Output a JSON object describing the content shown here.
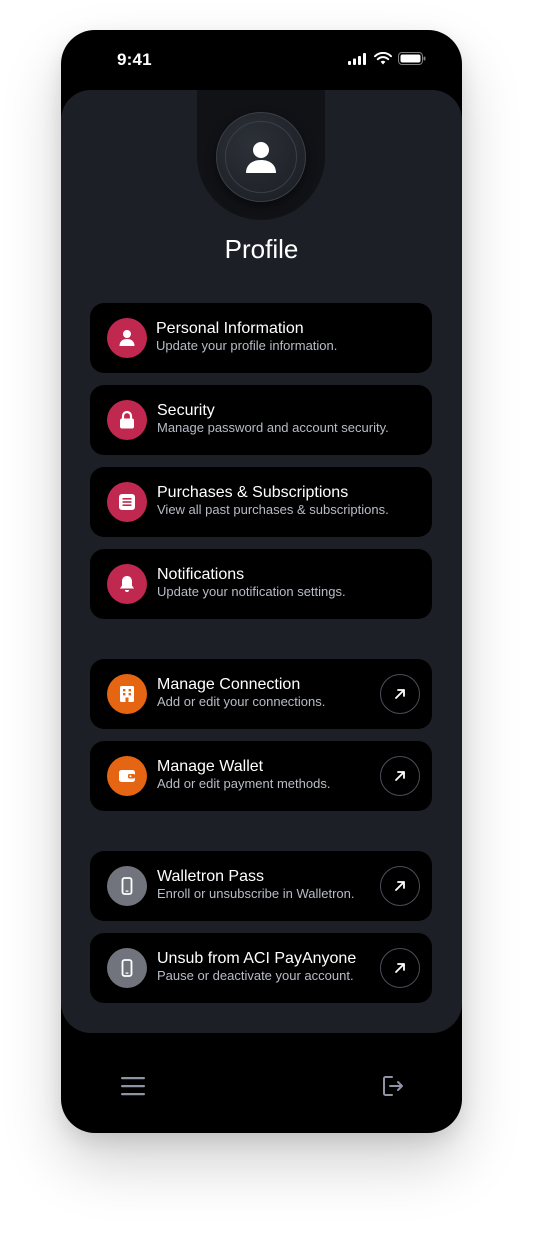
{
  "status_bar": {
    "time": "9:41",
    "icons": [
      "signal-icon",
      "wifi-icon",
      "battery-icon"
    ]
  },
  "profile": {
    "title": "Profile",
    "avatar_icon": "user-icon"
  },
  "colors": {
    "account_accent": "#c0284f",
    "wallet_accent": "#e56512",
    "device_accent": "#72747d",
    "panel_bg": "#1c1f26",
    "card_bg": "#000000"
  },
  "menu": {
    "personal": {
      "title": "Personal Information",
      "subtitle": "Update your profile information.",
      "icon": "user-icon"
    },
    "security": {
      "title": "Security",
      "subtitle": "Manage password and account security.",
      "icon": "lock-icon"
    },
    "purchases": {
      "title": "Purchases & Subscriptions",
      "subtitle": "View all past purchases & subscriptions.",
      "icon": "receipt-icon"
    },
    "notifications": {
      "title": "Notifications",
      "subtitle": "Update your notification settings.",
      "icon": "bell-icon"
    },
    "connection": {
      "title": "Manage Connection",
      "subtitle": "Add or edit your connections.",
      "icon": "building-icon"
    },
    "wallet": {
      "title": "Manage Wallet",
      "subtitle": "Add or edit payment methods.",
      "icon": "wallet-icon"
    },
    "walletron": {
      "title": "Walletron Pass",
      "subtitle": "Enroll or unsubscribe in Walletron.",
      "icon": "phone-icon"
    },
    "unsub": {
      "title": "Unsub from ACI PayAnyone",
      "subtitle": "Pause or deactivate your account.",
      "icon": "phone-icon"
    }
  },
  "bottom_bar": {
    "left_icon": "hamburger-menu-icon",
    "right_icon": "logout-icon"
  }
}
